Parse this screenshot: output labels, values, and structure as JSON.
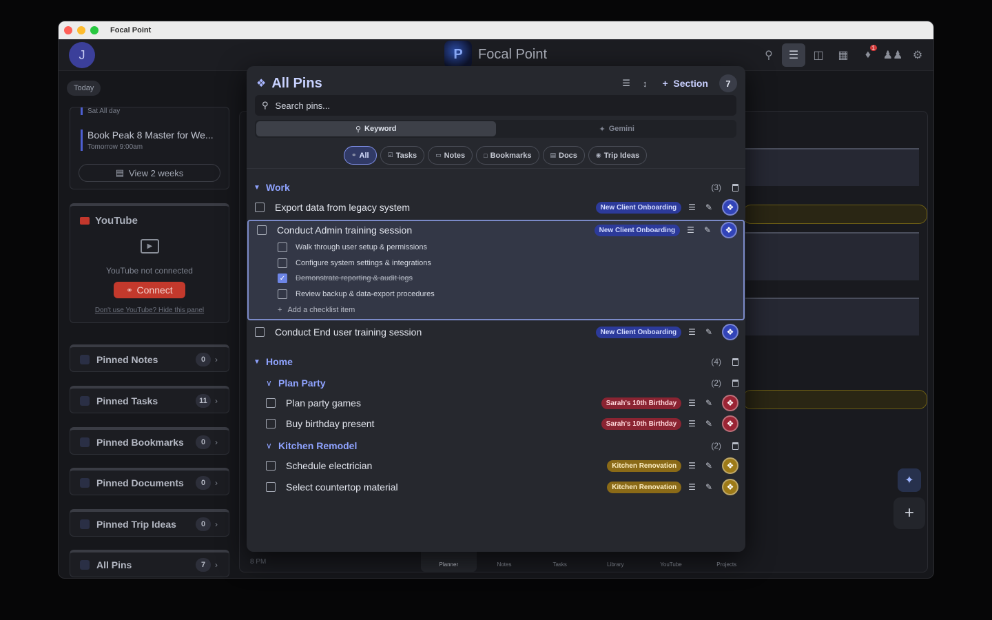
{
  "window": {
    "title": "Focal Point"
  },
  "appbar": {
    "avatar_letter": "J",
    "brand_title": "Focal Point",
    "notification_count": "1"
  },
  "sidebar": {
    "today_label": "Today",
    "events": [
      {
        "sub": "Sat All day",
        "title": ""
      },
      {
        "title": "Book Peak 8 Master for We...",
        "sub": "Tomorrow 9:00am"
      }
    ],
    "view_weeks_label": "View 2 weeks",
    "youtube": {
      "title": "YouTube",
      "message": "YouTube not connected",
      "connect_label": "Connect",
      "hide_label": "Don't use YouTube? Hide this panel"
    },
    "pin_panels": [
      {
        "label": "Pinned Notes",
        "count": "0"
      },
      {
        "label": "Pinned Tasks",
        "count": "11"
      },
      {
        "label": "Pinned Bookmarks",
        "count": "0"
      },
      {
        "label": "Pinned Documents",
        "count": "0"
      },
      {
        "label": "Pinned Trip Ideas",
        "count": "0"
      },
      {
        "label": "All Pins",
        "count": "7"
      }
    ]
  },
  "main": {
    "hour_label": "8 PM"
  },
  "bottom_nav": [
    {
      "label": "Planner",
      "active": true
    },
    {
      "label": "Notes"
    },
    {
      "label": "Tasks"
    },
    {
      "label": "Library"
    },
    {
      "label": "YouTube"
    },
    {
      "label": "Projects"
    }
  ],
  "pins_modal": {
    "title": "All Pins",
    "section_button": "Section",
    "total": "7",
    "search_placeholder": "Search pins...",
    "modes": {
      "keyword": "Keyword",
      "gemini": "Gemini"
    },
    "filters": [
      "All",
      "Tasks",
      "Notes",
      "Bookmarks",
      "Docs",
      "Trip Ideas"
    ],
    "sections": {
      "work": {
        "name": "Work",
        "count": "(3)",
        "items": [
          {
            "text": "Export data from legacy system",
            "tag": "New Client Onboarding"
          },
          {
            "text": "Conduct Admin training session",
            "tag": "New Client Onboarding",
            "checklist": [
              {
                "text": "Walk through user setup & permissions",
                "done": false
              },
              {
                "text": "Configure system settings & integrations",
                "done": false
              },
              {
                "text": "Demonstrate reporting & audit logs",
                "done": true
              },
              {
                "text": "Review backup & data-export procedures",
                "done": false
              }
            ],
            "add_checklist": "Add a checklist item"
          },
          {
            "text": "Conduct End user training session",
            "tag": "New Client Onboarding"
          }
        ]
      },
      "home": {
        "name": "Home",
        "count": "(4)",
        "groups": [
          {
            "name": "Plan Party",
            "count": "(2)",
            "items": [
              {
                "text": "Plan party games",
                "tag": "Sarah's 10th Birthday"
              },
              {
                "text": "Buy birthday present",
                "tag": "Sarah's 10th Birthday"
              }
            ]
          },
          {
            "name": "Kitchen Remodel",
            "count": "(2)",
            "items": [
              {
                "text": "Schedule electrician",
                "tag": "Kitchen Renovation"
              },
              {
                "text": "Select countertop material",
                "tag": "Kitchen Renovation"
              }
            ]
          }
        ]
      }
    }
  }
}
